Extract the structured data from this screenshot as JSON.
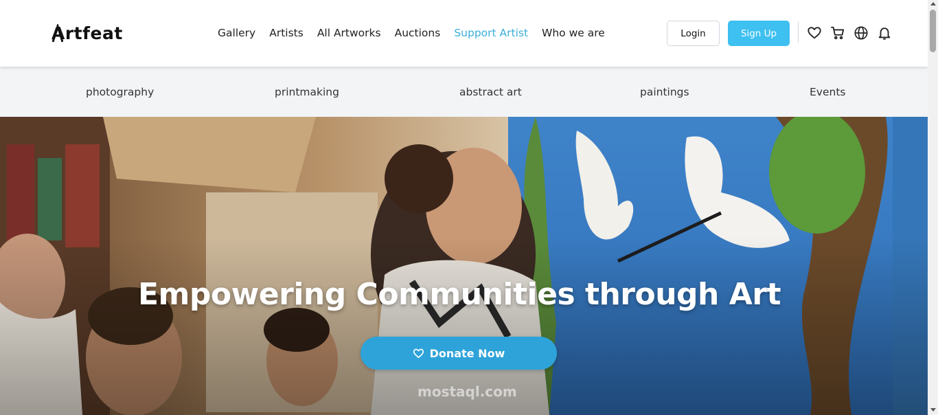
{
  "header": {
    "logo_text": "Artfeat",
    "nav": [
      {
        "label": "Gallery",
        "active": false
      },
      {
        "label": "Artists",
        "active": false
      },
      {
        "label": "All Artworks",
        "active": false
      },
      {
        "label": "Auctions",
        "active": false
      },
      {
        "label": "Support Artist",
        "active": true
      },
      {
        "label": "Who we are",
        "active": false
      }
    ],
    "login_label": "Login",
    "signup_label": "Sign Up",
    "icons": [
      "heart-icon",
      "cart-icon",
      "globe-icon",
      "bell-icon"
    ]
  },
  "categories": [
    {
      "label": "photography"
    },
    {
      "label": "printmaking"
    },
    {
      "label": "abstract art"
    },
    {
      "label": "paintings"
    },
    {
      "label": "Events"
    }
  ],
  "hero": {
    "title": "Empowering Communities through Art",
    "donate_label": "Donate Now",
    "donate_icon": "heart-outline-icon",
    "watermark": "mostaql.com"
  },
  "colors": {
    "accent": "#3aaed8",
    "signup_bg": "#3ec0f0",
    "donate_bg": "#2ea3d9",
    "category_bar_bg": "#f2f4f6"
  }
}
